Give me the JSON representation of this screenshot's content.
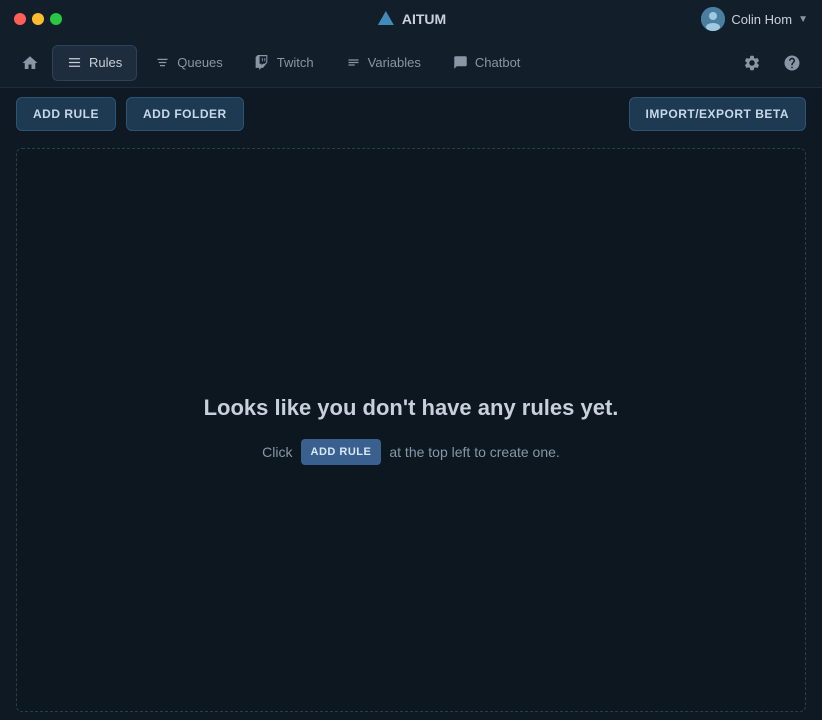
{
  "titlebar": {
    "app_name": "AITUM",
    "user_name": "Colin Hom"
  },
  "navbar": {
    "home_label": "Home",
    "tabs": [
      {
        "id": "rules",
        "label": "Rules",
        "icon": "rules-icon",
        "active": true
      },
      {
        "id": "queues",
        "label": "Queues",
        "icon": "queues-icon",
        "active": false
      },
      {
        "id": "twitch",
        "label": "Twitch",
        "icon": "twitch-icon",
        "active": false
      },
      {
        "id": "variables",
        "label": "Variables",
        "icon": "variables-icon",
        "active": false
      },
      {
        "id": "chatbot",
        "label": "Chatbot",
        "icon": "chatbot-icon",
        "active": false
      }
    ]
  },
  "toolbar": {
    "add_rule_label": "ADD RULE",
    "add_folder_label": "ADD FOLDER",
    "import_export_label": "IMPORT/EXPORT BETA"
  },
  "main": {
    "empty_title": "Looks like you don't have any rules yet.",
    "empty_subtitle_pre": "Click",
    "empty_subtitle_btn": "ADD RULE",
    "empty_subtitle_post": "at the top left to create one."
  },
  "colors": {
    "bg_dark": "#0f1923",
    "bg_panel": "#131e2b",
    "accent_blue": "#3a6090",
    "border_dashed": "#2a3d50"
  }
}
